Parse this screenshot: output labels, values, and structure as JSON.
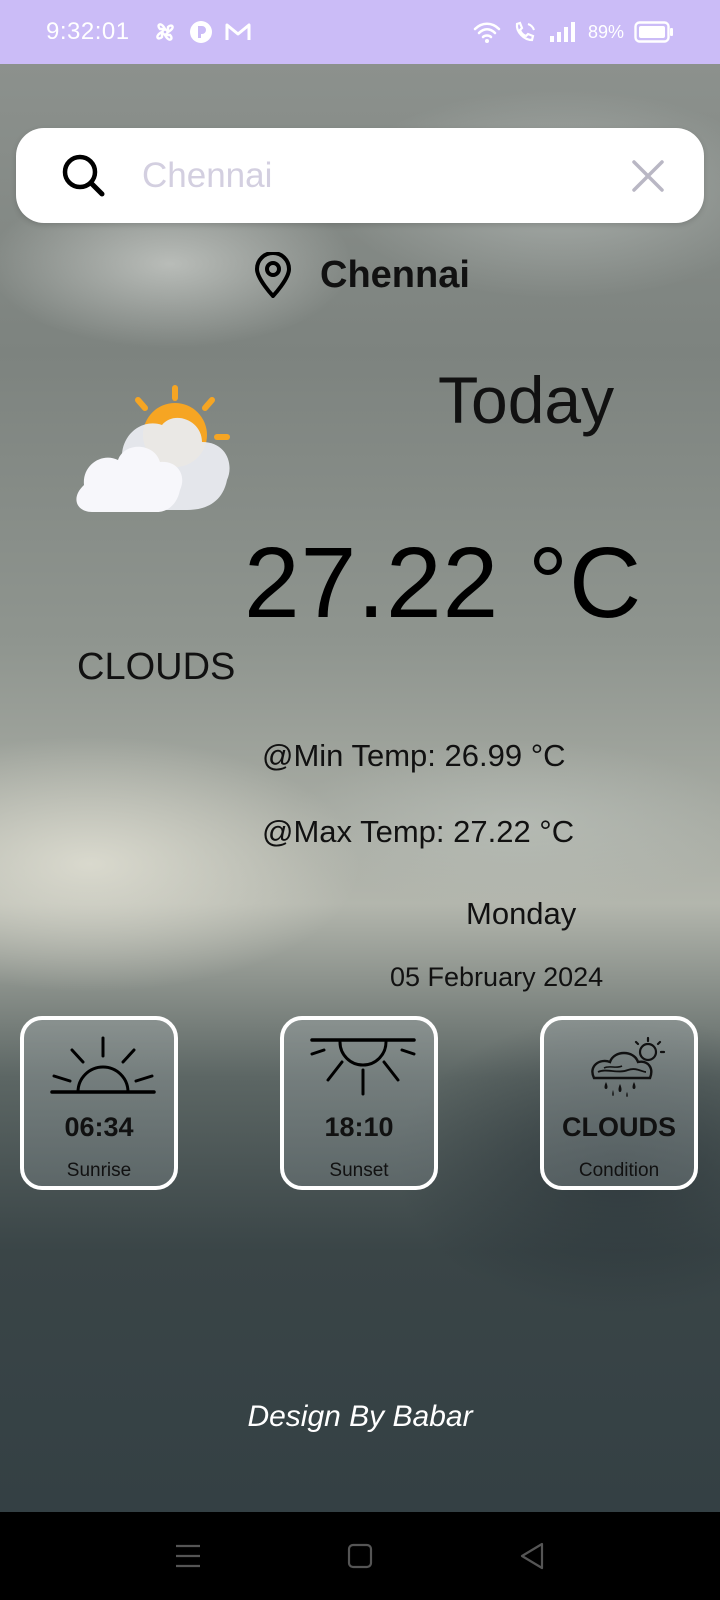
{
  "status_bar": {
    "time": "9:32:01",
    "battery": "89%"
  },
  "search": {
    "placeholder": "Chennai",
    "value": ""
  },
  "location": {
    "city": "Chennai"
  },
  "weather": {
    "today_label": "Today",
    "temperature": "27.22 °C",
    "condition": "CLOUDS",
    "min_temp": "@Min Temp: 26.99 °C",
    "max_temp": "@Max Temp: 27.22 °C",
    "day": "Monday",
    "date": "05 February 2024"
  },
  "cards": {
    "sunrise": {
      "value": "06:34",
      "label": "Sunrise"
    },
    "sunset": {
      "value": "18:10",
      "label": "Sunset"
    },
    "condition": {
      "value": "CLOUDS",
      "label": "Condition"
    }
  },
  "footer": {
    "credit": "Design By Babar"
  },
  "colors": {
    "status_bar": "#cbbcf7",
    "sun": "#f6a523",
    "card_border": "#ffffff"
  },
  "icons": {
    "search": "search-icon",
    "clear": "close-icon",
    "location": "location-pin-icon",
    "weather": "partly-cloudy-icon",
    "sunrise": "sunrise-icon",
    "sunset": "sunset-icon",
    "condition": "rain-cloud-sun-icon"
  }
}
